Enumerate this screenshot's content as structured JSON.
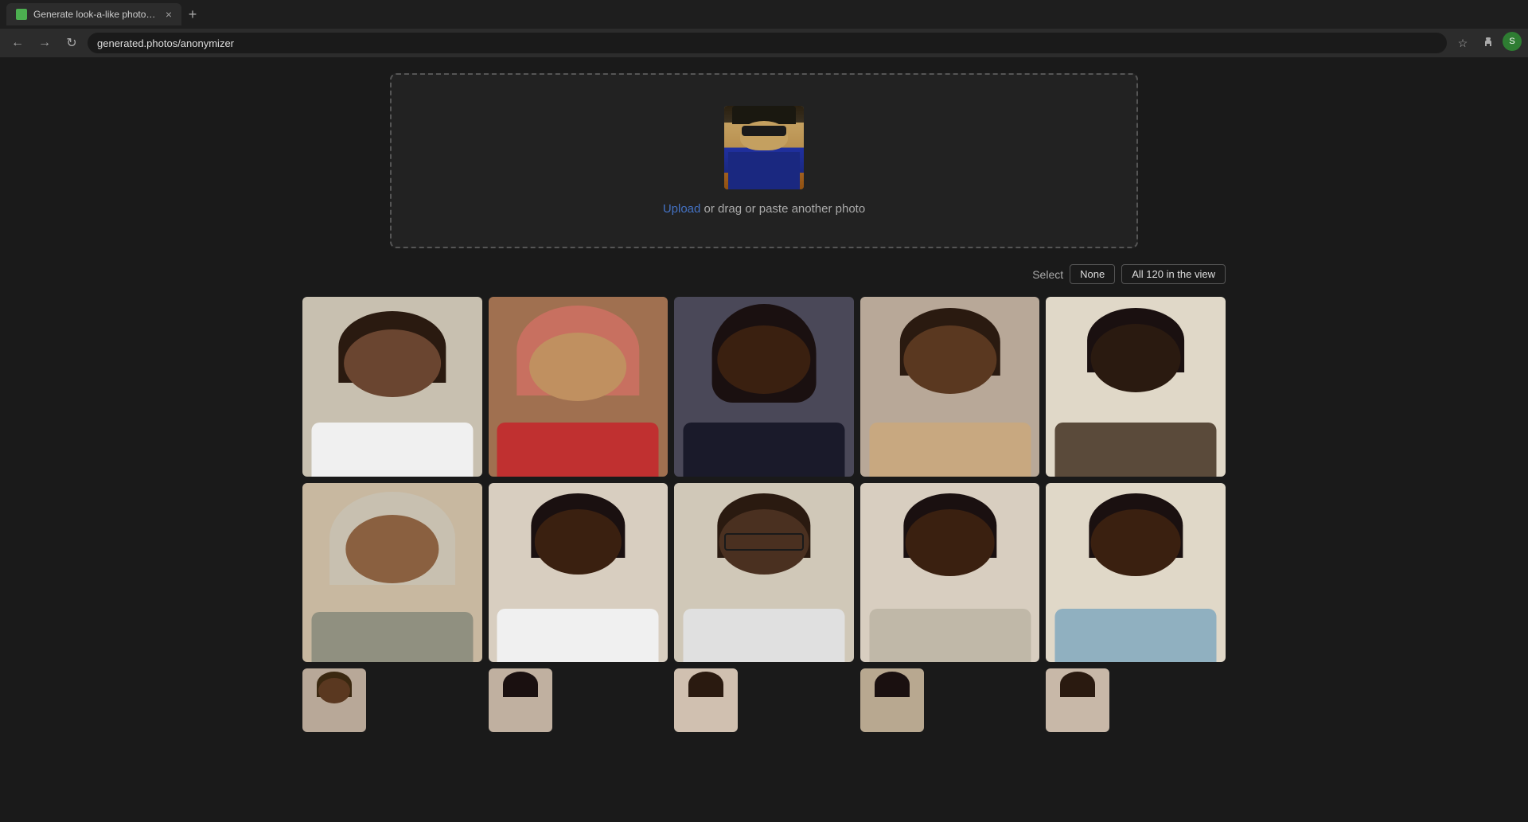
{
  "browser": {
    "tab": {
      "favicon_color": "#4CAF50",
      "title": "Generate look-a-like photos to p",
      "close_icon": "×"
    },
    "new_tab_icon": "+",
    "nav": {
      "back_icon": "←",
      "forward_icon": "→",
      "reload_icon": "↻",
      "url": "generated.photos/anonymizer",
      "bookmark_icon": "☆",
      "extensions_icon": "⚙",
      "profile_initial": "S"
    }
  },
  "upload": {
    "upload_link": "Upload",
    "upload_text": " or drag or paste another photo"
  },
  "results": {
    "select_label": "Select",
    "none_btn": "None",
    "all_btn": "All 120 in the view"
  },
  "photos": [
    {
      "id": 1,
      "bg": "#c8b8a0",
      "face_color": "#8B6B4A",
      "hair_color": "#2a1a10",
      "hair_type": "medium",
      "shirt_color": "#e0e0e0",
      "row": 1
    },
    {
      "id": 2,
      "bg": "#7a5a40",
      "face_color": "#c09060",
      "hair_color": "#c06060",
      "hair_type": "headscarf",
      "shirt_color": "#c03030",
      "row": 1
    },
    {
      "id": 3,
      "bg": "#3a3a4a",
      "face_color": "#4a3020",
      "hair_color": "#1a1210",
      "hair_type": "long",
      "shirt_color": "#1a1a2a",
      "row": 1
    },
    {
      "id": 4,
      "bg": "#c0b0a0",
      "face_color": "#5a4030",
      "hair_color": "#1a1210",
      "hair_type": "short",
      "shirt_color": "#c8a880",
      "row": 1
    },
    {
      "id": 5,
      "bg": "#e0d8c8",
      "face_color": "#4a3020",
      "hair_color": "#1a1210",
      "hair_type": "very_short",
      "shirt_color": "#5a4a3a",
      "row": 1
    },
    {
      "id": 6,
      "bg": "#d0c0a8",
      "face_color": "#8a6040",
      "hair_color": "#c8c8c8",
      "hair_type": "hijab",
      "shirt_color": "#908070",
      "row": 2
    },
    {
      "id": 7,
      "bg": "#e0d8c8",
      "face_color": "#5a3820",
      "hair_color": "#1a1210",
      "hair_type": "short",
      "shirt_color": "#f0f0f0",
      "row": 2
    },
    {
      "id": 8,
      "bg": "#d8d0c0",
      "face_color": "#5a4030",
      "hair_color": "#1a1210",
      "hair_type": "short",
      "shirt_color": "#e0e0e0",
      "row": 2
    },
    {
      "id": 9,
      "bg": "#e0d8c8",
      "face_color": "#6a4a30",
      "hair_color": "#1a1210",
      "hair_type": "short",
      "shirt_color": "#d0c8b8",
      "row": 2
    },
    {
      "id": 10,
      "bg": "#e8e0d0",
      "face_color": "#5a3820",
      "hair_color": "#1a1210",
      "hair_type": "short",
      "shirt_color": "#a0b8c0",
      "row": 2
    }
  ]
}
